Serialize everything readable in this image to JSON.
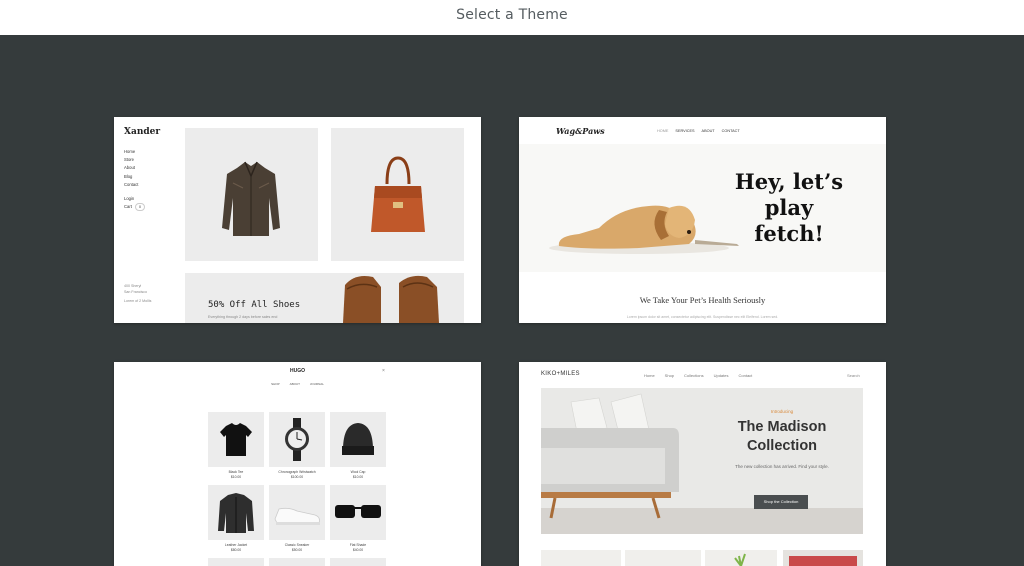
{
  "header": {
    "title": "Select a Theme"
  },
  "themes": {
    "xander": {
      "logo": "Xander",
      "nav": [
        "Home",
        "Store",
        "About",
        "Blog",
        "Contact"
      ],
      "login": "Login",
      "cart": "Cart",
      "cart_count": "0",
      "footer": [
        "400 Sheryl",
        "San Francisco",
        "Lorem of 2 Mollis"
      ],
      "banner_title": "50% Off All Shoes",
      "banner_sub": "Everything through 2 days before sales end"
    },
    "wagpaws": {
      "logo": "Wag&Paws",
      "nav": [
        "HOME",
        "SERVICES",
        "ABOUT",
        "CONTACT"
      ],
      "headline": "Hey, let’s play fetch!",
      "tagline": "We Take Your Pet’s Health Seriously",
      "tagline_sub": "Lorem ipsum dolor sit amet, consectetur adipiscing elit. Suspendisse nec elit Eleifend. Lorem sed."
    },
    "hugo": {
      "logo": "HUGO",
      "close": "×",
      "nav": [
        "SHOP",
        "ABOUT",
        "JOURNAL"
      ],
      "products": [
        {
          "name": "Black Tee",
          "price": "$10.00"
        },
        {
          "name": "Chronograph Wristwatch",
          "price": "$100.00"
        },
        {
          "name": "Wool Cap",
          "price": "$10.00"
        },
        {
          "name": "Leather Jacket",
          "price": "$80.00"
        },
        {
          "name": "Classic Sneaker",
          "price": "$50.00"
        },
        {
          "name": "Flat Shade",
          "price": "$40.00"
        }
      ]
    },
    "kikomiles": {
      "logo": "KIKO+MILES",
      "nav": [
        "Home",
        "Shop",
        "Collections",
        "Updates",
        "Contact"
      ],
      "search": "Search",
      "hero_intro": "Introducing",
      "hero_title": "The Madison Collection",
      "hero_sub": "The new collection has arrived. Find your style.",
      "hero_button": "Shop the Collection"
    }
  }
}
